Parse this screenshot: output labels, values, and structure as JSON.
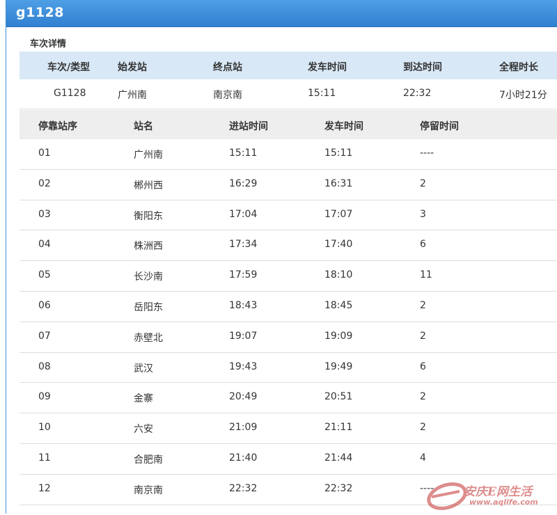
{
  "window": {
    "title": "g1128"
  },
  "summary": {
    "section_title": "车次详情",
    "headers": [
      "车次/类型",
      "始发站",
      "终点站",
      "发车时间",
      "到达时间",
      "全程时长"
    ],
    "values": [
      "G1128",
      "广州南",
      "南京南",
      "15:11",
      "22:32",
      "7小时21分"
    ]
  },
  "stops": {
    "headers": [
      "停靠站序",
      "站名",
      "进站时间",
      "发车时间",
      "停留时间"
    ],
    "rows": [
      [
        "01",
        "广州南",
        "15:11",
        "15:11",
        "----"
      ],
      [
        "02",
        "郴州西",
        "16:29",
        "16:31",
        "2"
      ],
      [
        "03",
        "衡阳东",
        "17:04",
        "17:07",
        "3"
      ],
      [
        "04",
        "株洲西",
        "17:34",
        "17:40",
        "6"
      ],
      [
        "05",
        "长沙南",
        "17:59",
        "18:10",
        "11"
      ],
      [
        "06",
        "岳阳东",
        "18:43",
        "18:45",
        "2"
      ],
      [
        "07",
        "赤壁北",
        "19:07",
        "19:09",
        "2"
      ],
      [
        "08",
        "武汉",
        "19:43",
        "19:49",
        "6"
      ],
      [
        "09",
        "金寨",
        "20:49",
        "20:51",
        "2"
      ],
      [
        "10",
        "六安",
        "21:09",
        "21:11",
        "2"
      ],
      [
        "11",
        "合肥南",
        "21:40",
        "21:44",
        "4"
      ],
      [
        "12",
        "南京南",
        "22:32",
        "22:32",
        "----"
      ]
    ]
  },
  "watermark": {
    "text": "安庆E网生活",
    "url": "www.aqlife.com"
  },
  "colors": {
    "titlebar": "#2f80d0",
    "summary_header_bg": "#d8e8f6",
    "stops_header_bg": "#eeeeee"
  }
}
